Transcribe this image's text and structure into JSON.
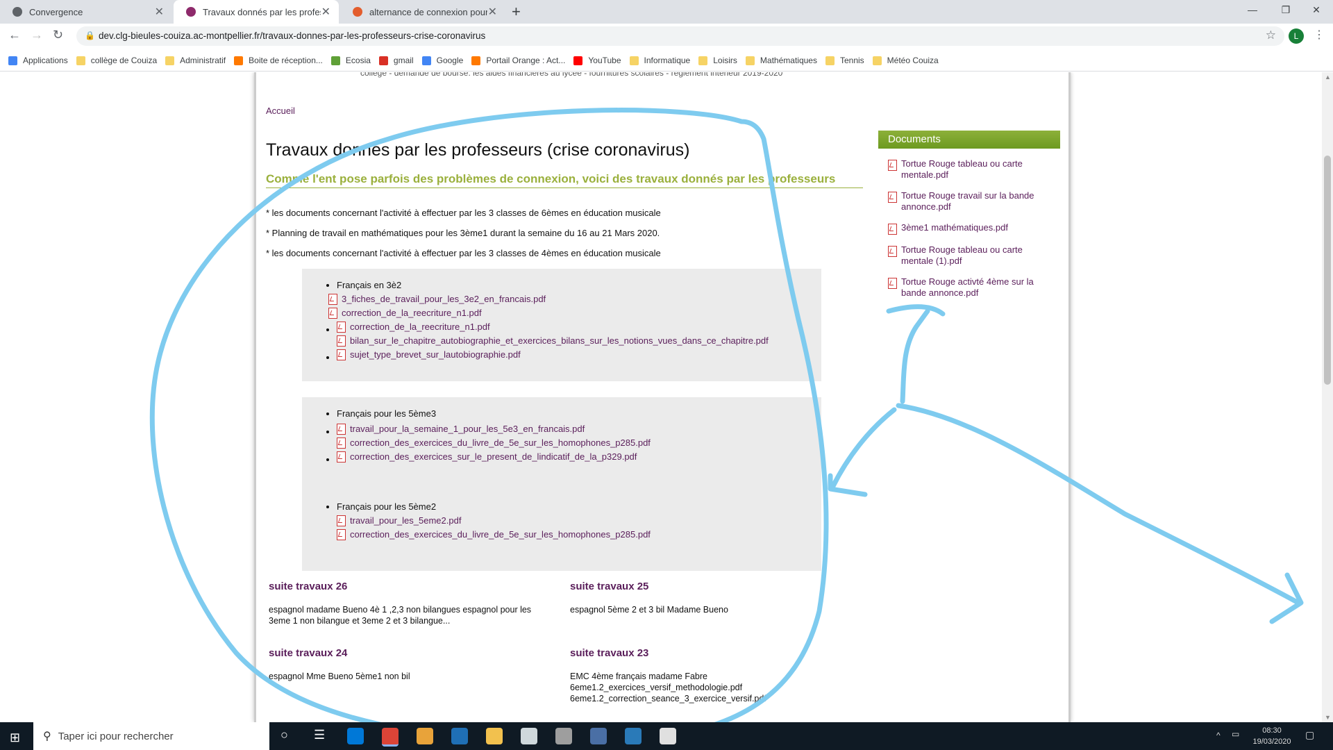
{
  "browser": {
    "tabs": [
      {
        "label": "Convergence",
        "active": false,
        "color": "#5f6368"
      },
      {
        "label": "Travaux donnés par les professeurs",
        "active": true,
        "color": "#8e2a6b"
      },
      {
        "label": "alternance de connexion pour ne",
        "active": false,
        "color": "#e35d2d"
      }
    ],
    "new_tab": "+",
    "url": "dev.clg-bieules-couiza.ac-montpellier.fr/travaux-donnes-par-les-professeurs-crise-coronavirus",
    "profile_initial": "L",
    "bookmarks": [
      {
        "label": "Applications",
        "color": "#4285f4"
      },
      {
        "label": "collège de Couiza",
        "color": "#f6d365"
      },
      {
        "label": "Administratif",
        "color": "#f6d365"
      },
      {
        "label": "Boite de réception...",
        "color": "#ff7900"
      },
      {
        "label": "Ecosia",
        "color": "#5fa037"
      },
      {
        "label": "gmail",
        "color": "#d93025"
      },
      {
        "label": "Google",
        "color": "#4285f4"
      },
      {
        "label": "Portail Orange : Act...",
        "color": "#ff7900"
      },
      {
        "label": "YouTube",
        "color": "#ff0000"
      },
      {
        "label": "Informatique",
        "color": "#f6d365"
      },
      {
        "label": "Loisirs",
        "color": "#f6d365"
      },
      {
        "label": "Mathématiques",
        "color": "#f6d365"
      },
      {
        "label": "Tennis",
        "color": "#f6d365"
      },
      {
        "label": "Météo Couiza",
        "color": "#f6d365"
      }
    ]
  },
  "page": {
    "top_cut": "collège - demande de bourse: les aides financières au lycée - fournitures scolaires - règlement intérieur 2019-2020",
    "breadcrumb": "Accueil",
    "title": "Travaux donnés par les professeurs (crise coronavirus)",
    "subtitle": "Comme l'ent pose parfois des problèmes de connexion, voici des travaux donnés par les professeurs",
    "intro": [
      "*  les documents concernant l'activité à effectuer par les 3 classes de 6èmes en éducation musicale",
      "* Planning de travail en mathématiques pour les 3ème1 durant la semaine du 16 au 21 Mars 2020.",
      "*  les documents concernant l'activité à effectuer par les 3 classes de 4èmes en éducation musicale"
    ],
    "box1": {
      "heading": "Français en 3è2",
      "files": [
        "3_fiches_de_travail_pour_les_3e2_en_francais.pdf",
        "correction_de_la_reecriture_n1.pdf",
        "correction_de_la_reecriture_n1.pdf",
        "bilan_sur_le_chapitre_autobiographie_et_exercices_bilans_sur_les_notions_vues_dans_ce_chapitre.pdf",
        "sujet_type_brevet_sur_lautobiographie.pdf"
      ]
    },
    "box2": {
      "heading": "Français pour les 5ème3",
      "files": [
        "travail_pour_la_semaine_1_pour_les_5e3_en_francais.pdf",
        "correction_des_exercices_du_livre_de_5e_sur_les_homophones_p285.pdf",
        "correction_des_exercices_sur_le_present_de_lindicatif_de_la_p329.pdf"
      ],
      "heading2": "Français pour les 5ème2",
      "files2": [
        "travail_pour_les_5eme2.pdf",
        "correction_des_exercices_du_livre_de_5e_sur_les_homophones_p285.pdf"
      ]
    },
    "news": [
      {
        "title": "suite travaux 26",
        "body": "espagnol madame Bueno 4è 1 ,2,3 non bilangues espagnol pour les 3eme 1 non bilangue et 3eme 2 et 3 bilangue..."
      },
      {
        "title": "suite travaux 25",
        "body": "espagnol 5ème 2 et 3 bil Madame Bueno"
      },
      {
        "title": "suite travaux 24",
        "body": "espagnol Mme Bueno 5ème1 non bil"
      },
      {
        "title": "suite travaux 23",
        "body": "EMC 4ème français madame Fabre 6eme1.2_exercices_versif_methodologie.pdf 6eme1.2_correction_seance_3_exercice_versif.pdf"
      }
    ],
    "documents": {
      "heading": "Documents",
      "items": [
        "Tortue Rouge tableau ou carte mentale.pdf",
        "Tortue Rouge travail sur la bande annonce.pdf",
        "3ème1 mathématiques.pdf",
        "Tortue Rouge tableau ou carte mentale (1).pdf",
        "Tortue Rouge activté 4ème sur la bande annonce.pdf"
      ]
    },
    "annotation_color": "#7ecbef"
  },
  "taskbar": {
    "search_placeholder": "Taper ici pour rechercher",
    "time": "08:30",
    "date": "19/03/2020"
  }
}
